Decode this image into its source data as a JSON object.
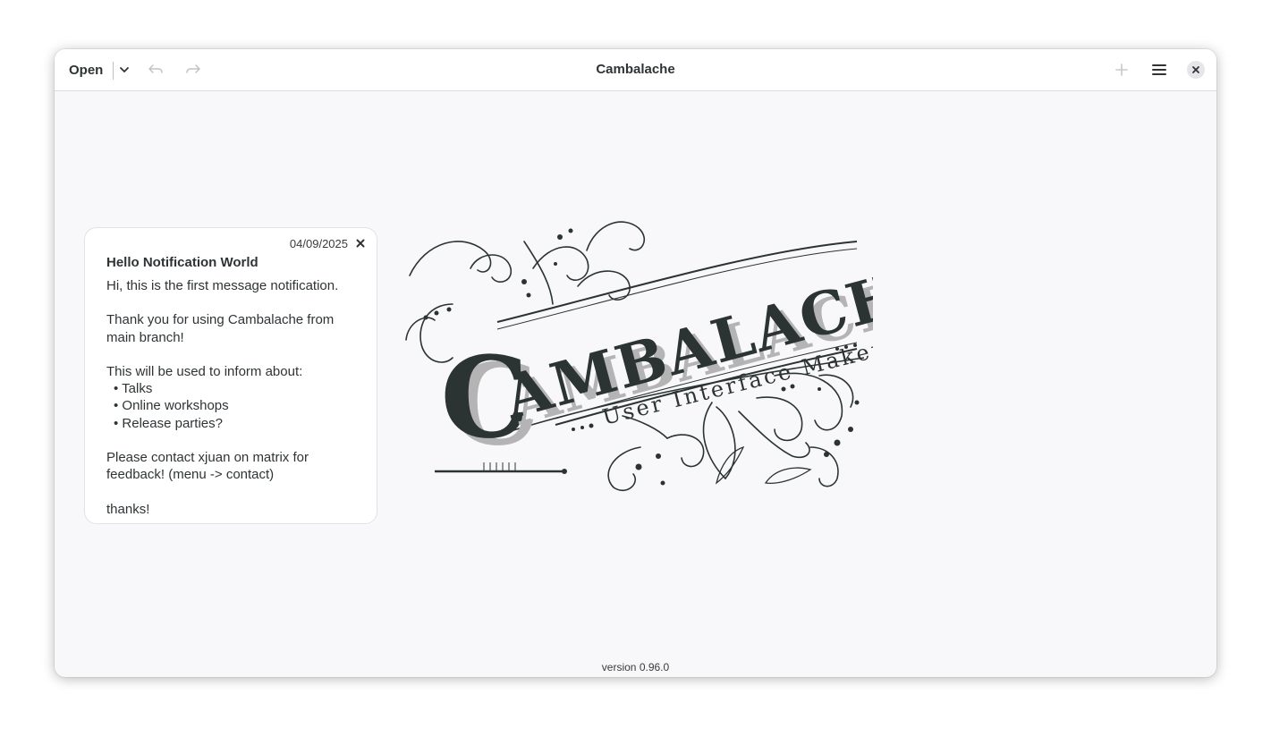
{
  "header": {
    "open_label": "Open",
    "title": "Cambalache",
    "icons": {
      "open_menu": "chevron-down-icon",
      "undo": "undo-icon",
      "redo": "redo-icon",
      "add": "plus-icon",
      "menu": "hamburger-menu-icon",
      "close": "close-icon"
    }
  },
  "notification": {
    "date": "04/09/2025",
    "title": "Hello Notification World",
    "line1": "Hi, this is the first message notification.",
    "line2": "Thank you for using Cambalache from main branch!",
    "line3": "This will be used to inform about:",
    "bullets": [
      "• Talks",
      "• Online workshops",
      "• Release parties?"
    ],
    "line4": "Please contact xjuan on matrix for feedback! (menu -> contact)",
    "line5": "thanks!"
  },
  "logo": {
    "name": "CAMBALACHE",
    "tagline": "User Interface Maker"
  },
  "footer": {
    "version": "version 0.96.0"
  },
  "colors": {
    "ink": "#2b3333",
    "shadow": "#b4b4b4",
    "window_bg": "#f8f8fa",
    "header_bg": "#ffffff"
  }
}
